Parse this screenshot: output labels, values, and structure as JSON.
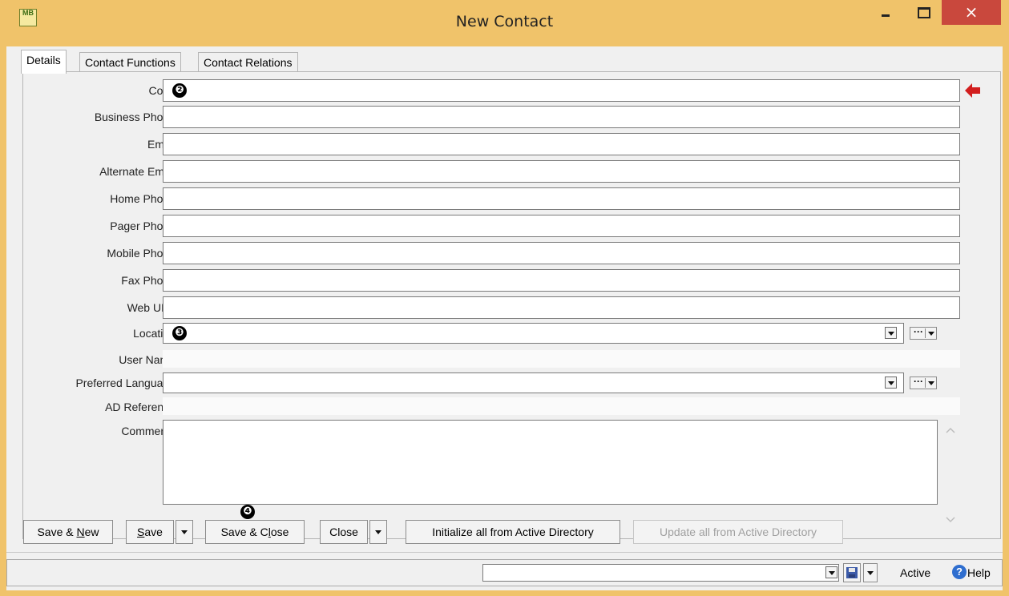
{
  "window": {
    "title": "New Contact",
    "app_icon_text": "MB",
    "close_glyph": "×"
  },
  "tabs": [
    {
      "label": "Details",
      "active": true
    },
    {
      "label": "Contact Functions",
      "active": false
    },
    {
      "label": "Contact Relations",
      "active": false
    }
  ],
  "form": {
    "code_label": "Code",
    "code_value": "",
    "business_phone_label": "Business Phone",
    "email_label": "Email",
    "alternate_email_label": "Alternate Email",
    "home_phone_label": "Home Phone",
    "pager_phone_label": "Pager Phone",
    "mobile_phone_label": "Mobile Phone",
    "fax_phone_label": "Fax Phone",
    "web_url_label": "Web URL",
    "location_label": "Location",
    "location_value": "",
    "user_name_label": "User Name",
    "preferred_language_label": "Preferred Language",
    "ad_reference_label": "AD Reference",
    "comments_label": "Comments",
    "ellipsis": "···"
  },
  "annotations": {
    "code_badge": "❷",
    "location_badge": "❸",
    "save_close_badge": "❹"
  },
  "buttons": {
    "save_new_prefix": "Save & ",
    "save_new_accel": "N",
    "save_new_suffix": "ew",
    "save_accel": "S",
    "save_suffix": "ave",
    "save_close_prefix": "Save & C",
    "save_close_accel": "l",
    "save_close_suffix": "ose",
    "close_label": "Close",
    "init_ad_label": "Initialize all from Active Directory",
    "update_ad_label": "Update all from Active Directory"
  },
  "statusbar": {
    "status_value": "",
    "status_text": "Active",
    "help_glyph": "?",
    "help_label": "Help"
  },
  "colors": {
    "title_bar": "#f0c36a",
    "close_button": "#c9483d",
    "required_arrow": "#d21e1e",
    "help_icon": "#2f6ecf"
  }
}
